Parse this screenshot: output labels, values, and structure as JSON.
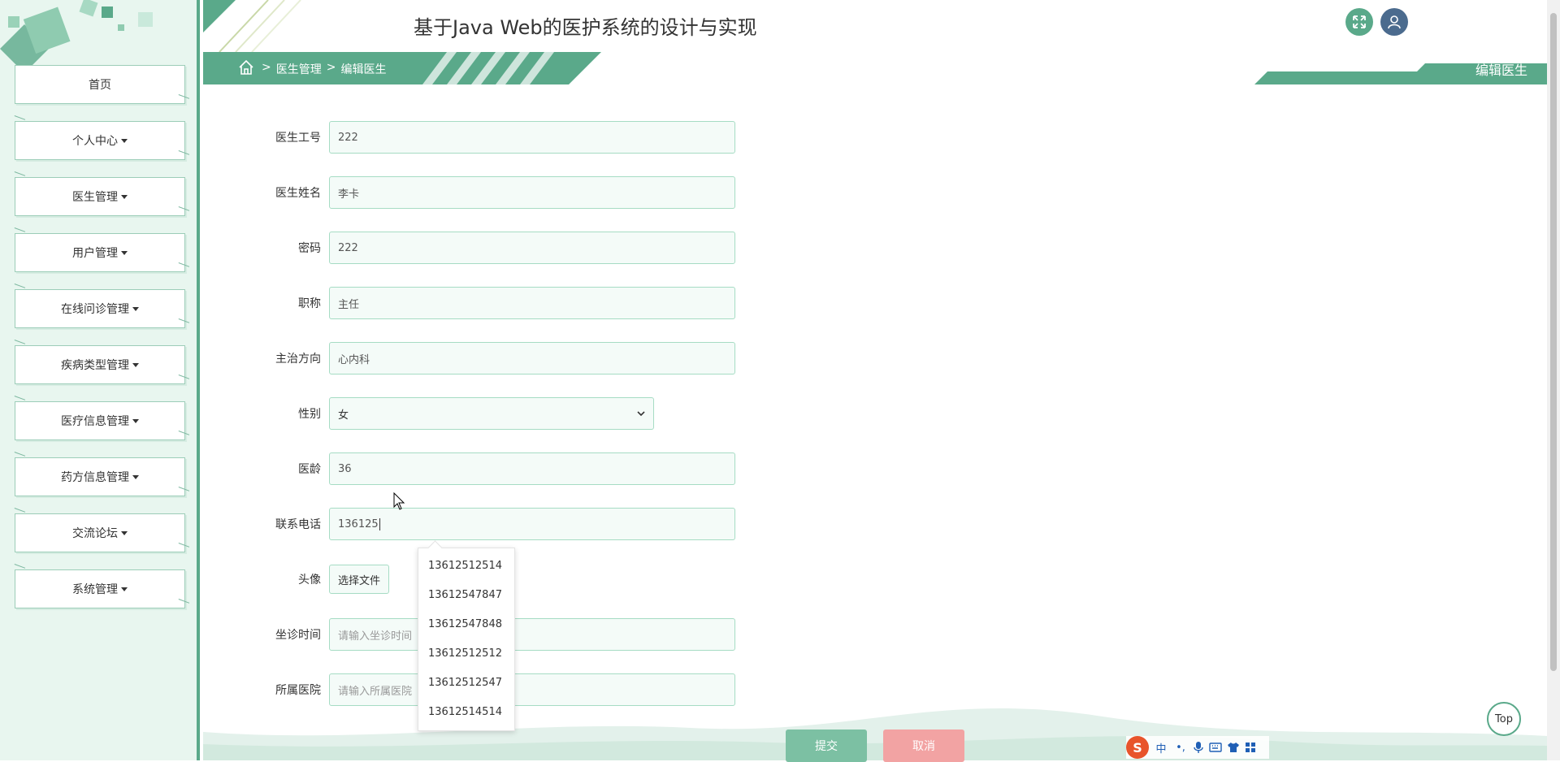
{
  "app": {
    "title": "基于Java Web的医护系统的设计与实现"
  },
  "sidebar": {
    "items": [
      {
        "label": "首页",
        "has_caret": false
      },
      {
        "label": "个人中心",
        "has_caret": true
      },
      {
        "label": "医生管理",
        "has_caret": true
      },
      {
        "label": "用户管理",
        "has_caret": true
      },
      {
        "label": "在线问诊管理",
        "has_caret": true
      },
      {
        "label": "疾病类型管理",
        "has_caret": true
      },
      {
        "label": "医疗信息管理",
        "has_caret": true
      },
      {
        "label": "药方信息管理",
        "has_caret": true
      },
      {
        "label": "交流论坛",
        "has_caret": true
      },
      {
        "label": "系统管理",
        "has_caret": true
      }
    ]
  },
  "breadcrumb": {
    "separator": ">",
    "items": [
      "医生管理",
      "编辑医生"
    ]
  },
  "page_tab": {
    "label": "编辑医生"
  },
  "form": {
    "doctor_id": {
      "label": "医生工号",
      "value": "222"
    },
    "doctor_name": {
      "label": "医生姓名",
      "value": "李卡"
    },
    "password": {
      "label": "密码",
      "value": "222"
    },
    "title": {
      "label": "职称",
      "value": "主任"
    },
    "specialty": {
      "label": "主治方向",
      "value": "心内科"
    },
    "gender": {
      "label": "性别",
      "value": "女"
    },
    "years": {
      "label": "医龄",
      "value": "36"
    },
    "phone": {
      "label": "联系电话",
      "value": "136125"
    },
    "avatar": {
      "label": "头像",
      "button": "选择文件"
    },
    "clinic_time": {
      "label": "坐诊时间",
      "placeholder": "请输入坐诊时间"
    },
    "hospital": {
      "label": "所属医院",
      "placeholder": "请输入所属医院"
    }
  },
  "autocomplete": {
    "options": [
      "13612512514",
      "13612547847",
      "13612547848",
      "13612512512",
      "13612512547",
      "13612514514"
    ]
  },
  "actions": {
    "submit": "提交",
    "cancel": "取消",
    "top": "Top"
  },
  "ime": {
    "logo": "S",
    "mode": "中",
    "punct": "•,"
  },
  "colors": {
    "accent": "#5aa98a",
    "sidebar_bg": "#e8f6ef",
    "user_icon": "#4b6b8e",
    "cancel": "#f2a3a3",
    "submit": "#7cc0a3"
  }
}
